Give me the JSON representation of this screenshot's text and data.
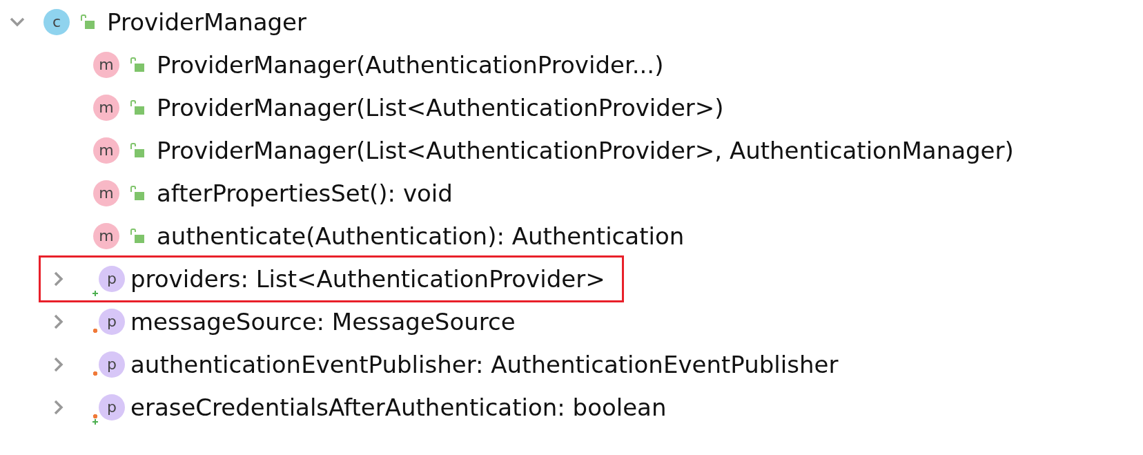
{
  "tree": {
    "kind": "class",
    "badge": "c",
    "label": "ProviderManager",
    "expanded": true,
    "children": [
      {
        "kind": "method",
        "badge": "m",
        "label": "ProviderManager(AuthenticationProvider...)"
      },
      {
        "kind": "method",
        "badge": "m",
        "label": "ProviderManager(List<AuthenticationProvider>)"
      },
      {
        "kind": "method",
        "badge": "m",
        "label": "ProviderManager(List<AuthenticationProvider>, AuthenticationManager)"
      },
      {
        "kind": "method",
        "badge": "m",
        "label": "afterPropertiesSet(): void"
      },
      {
        "kind": "method",
        "badge": "m",
        "label": "authenticate(Authentication): Authentication"
      },
      {
        "kind": "field",
        "badge": "p",
        "label": "providers: List<AuthenticationProvider>",
        "expanded": false,
        "highlighted": true,
        "public_mark": true,
        "private_mark": false
      },
      {
        "kind": "field",
        "badge": "p",
        "label": "messageSource: MessageSource",
        "expanded": false,
        "highlighted": false,
        "public_mark": false,
        "private_mark": true
      },
      {
        "kind": "field",
        "badge": "p",
        "label": "authenticationEventPublisher: AuthenticationEventPublisher",
        "expanded": false,
        "highlighted": false,
        "public_mark": false,
        "private_mark": true
      },
      {
        "kind": "field",
        "badge": "p",
        "label": "eraseCredentialsAfterAuthentication: boolean",
        "expanded": false,
        "highlighted": false,
        "public_mark": true,
        "private_mark": true
      }
    ]
  }
}
